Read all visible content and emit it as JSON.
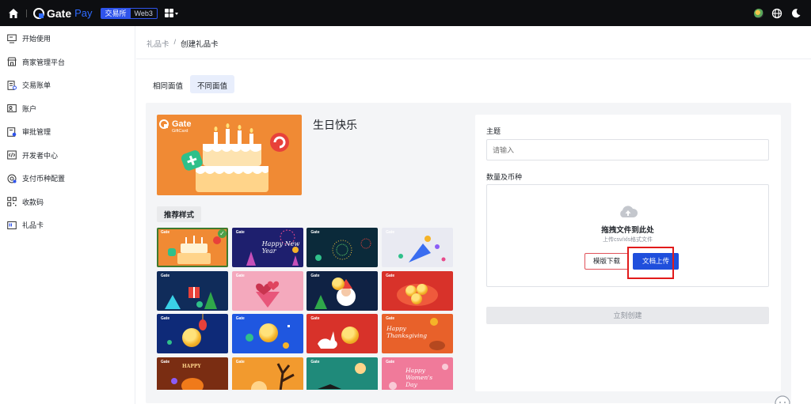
{
  "topbar": {
    "logo_text": "Gate",
    "logo_suffix": "Pay",
    "segments": [
      "交易所",
      "Web3"
    ],
    "icons": [
      "home-icon",
      "apps-grid-icon",
      "avatar",
      "globe-icon",
      "moon-icon"
    ]
  },
  "sidebar": {
    "items": [
      {
        "label": "开始使用",
        "icon": "monitor-icon"
      },
      {
        "label": "商家管理平台",
        "icon": "store-icon"
      },
      {
        "label": "交易账单",
        "icon": "bill-icon"
      },
      {
        "label": "账户",
        "icon": "account-icon"
      },
      {
        "label": "审批管理",
        "icon": "approval-icon"
      },
      {
        "label": "开发者中心",
        "icon": "code-icon"
      },
      {
        "label": "支付币种配置",
        "icon": "currency-icon"
      },
      {
        "label": "收款码",
        "icon": "qrcode-icon"
      },
      {
        "label": "礼品卡",
        "icon": "gift-card-icon"
      }
    ]
  },
  "breadcrumb": {
    "parent": "礼品卡",
    "separator": "/",
    "current": "创建礼品卡"
  },
  "tabs": [
    {
      "label": "相同面值",
      "active": false
    },
    {
      "label": "不同面值",
      "active": true
    }
  ],
  "preview": {
    "brand": "Gate",
    "brand_sub": "GiftCard",
    "title": "生日快乐"
  },
  "recommended_label": "推荐样式",
  "templates": [
    {
      "name": "birthday",
      "selected": true,
      "text": ""
    },
    {
      "name": "happy-new-year",
      "selected": false,
      "text": "Happy New Year"
    },
    {
      "name": "fireworks",
      "selected": false,
      "text": ""
    },
    {
      "name": "party-popper",
      "selected": false,
      "text": ""
    },
    {
      "name": "christmas-gift",
      "selected": false,
      "text": ""
    },
    {
      "name": "valentine",
      "selected": false,
      "text": ""
    },
    {
      "name": "santa",
      "selected": false,
      "text": ""
    },
    {
      "name": "red-coins",
      "selected": false,
      "text": ""
    },
    {
      "name": "lantern",
      "selected": false,
      "text": ""
    },
    {
      "name": "bitcoin",
      "selected": false,
      "text": ""
    },
    {
      "name": "rabbit",
      "selected": false,
      "text": ""
    },
    {
      "name": "thanksgiving",
      "selected": false,
      "text": "Happy Thanksgiving"
    },
    {
      "name": "halloween-pumpkin",
      "selected": false,
      "text": "HAPPY"
    },
    {
      "name": "halloween-tree",
      "selected": false,
      "text": ""
    },
    {
      "name": "witch",
      "selected": false,
      "text": ""
    },
    {
      "name": "womens-day",
      "selected": false,
      "text": "Happy Women's Day"
    }
  ],
  "form": {
    "subject_label": "主题",
    "subject_placeholder": "请输入",
    "quantity_label": "数量及币种",
    "upload_title": "拖拽文件到此处",
    "upload_sub": "上传csv/xls格式文件",
    "template_download": "模版下载",
    "doc_upload": "文档上传",
    "create_button": "立刻创建"
  },
  "colors": {
    "accent": "#1f4fdc",
    "highlight_box": "#e21b1b",
    "topbar_bg": "#0d0e11",
    "card_orange": "#f08a34"
  }
}
